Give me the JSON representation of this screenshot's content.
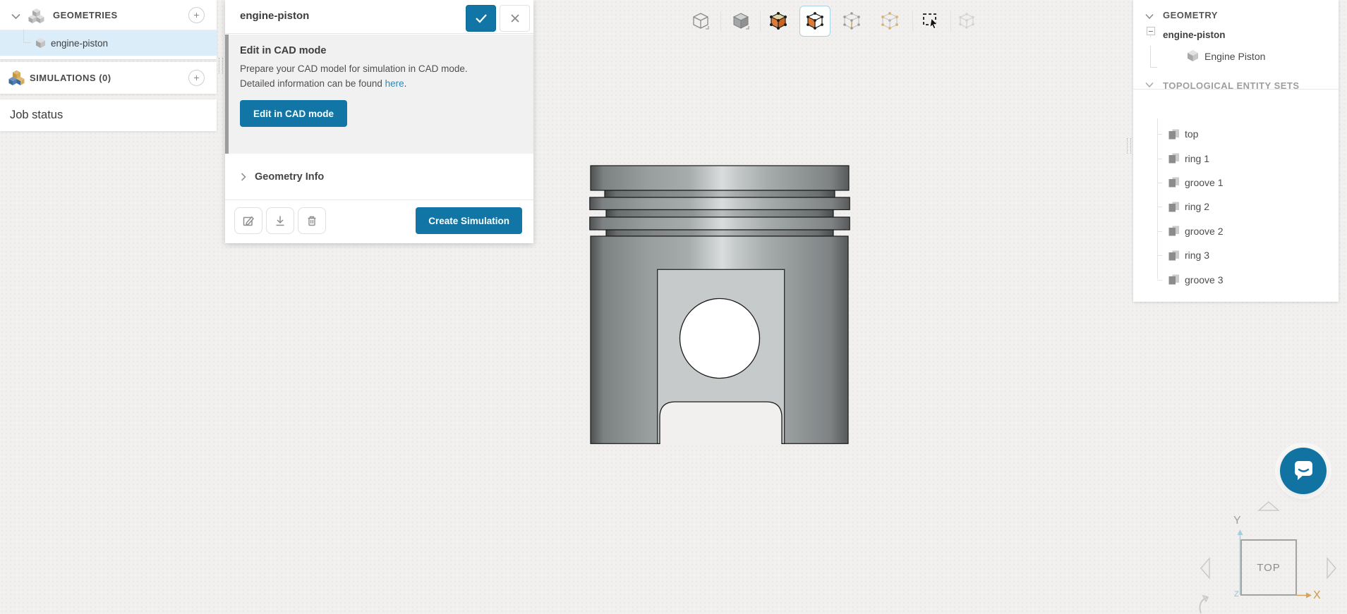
{
  "colors": {
    "primary_blue": "#1176a5",
    "link_blue": "#2d8ab3",
    "selected_row_bg": "#daedf8",
    "toolbar_active_border": "#a9d2e6",
    "axis_x_color": "#cd9a4c",
    "axis_z_color": "#8fc0d4"
  },
  "left_sidebar": {
    "geometries_header": "GEOMETRIES",
    "geometries_add": "+",
    "geometry_item": "engine-piston",
    "simulations_header": "SIMULATIONS (0)",
    "simulations_add": "+",
    "job_status": "Job status"
  },
  "geometry_panel": {
    "title": "engine-piston",
    "edit_cad_heading": "Edit in CAD mode",
    "edit_cad_line1": "Prepare your CAD model for simulation in CAD mode.",
    "edit_cad_line2_before_link": "Detailed information can be found ",
    "edit_cad_link": "here",
    "edit_cad_line2_after_link": ".",
    "edit_cad_button": "Edit in CAD mode",
    "geometry_info": "Geometry Info",
    "create_simulation": "Create Simulation",
    "header_icons": [
      "check-icon",
      "close-icon"
    ],
    "footer_icons": [
      "edit-icon",
      "download-icon",
      "delete-icon"
    ]
  },
  "viewport_toolbar": {
    "tools": [
      "wireframe-view",
      "shaded-view",
      "select-volumes",
      "select-faces",
      "select-edges",
      "select-vertices",
      "box-select",
      "hide-selection"
    ],
    "active_tool": "select-faces"
  },
  "right_panel": {
    "geometry_header": "GEOMETRY",
    "root_item": "engine-piston",
    "child_item": "Engine Piston",
    "topo_header": "TOPOLOGICAL ENTITY SETS",
    "topo_items": [
      "top",
      "ring 1",
      "groove 1",
      "ring 2",
      "groove 2",
      "ring 3",
      "groove 3"
    ]
  },
  "nav_cube": {
    "face_label": "TOP",
    "axis_x": "X",
    "axis_y": "Y",
    "axis_z": "Z"
  }
}
